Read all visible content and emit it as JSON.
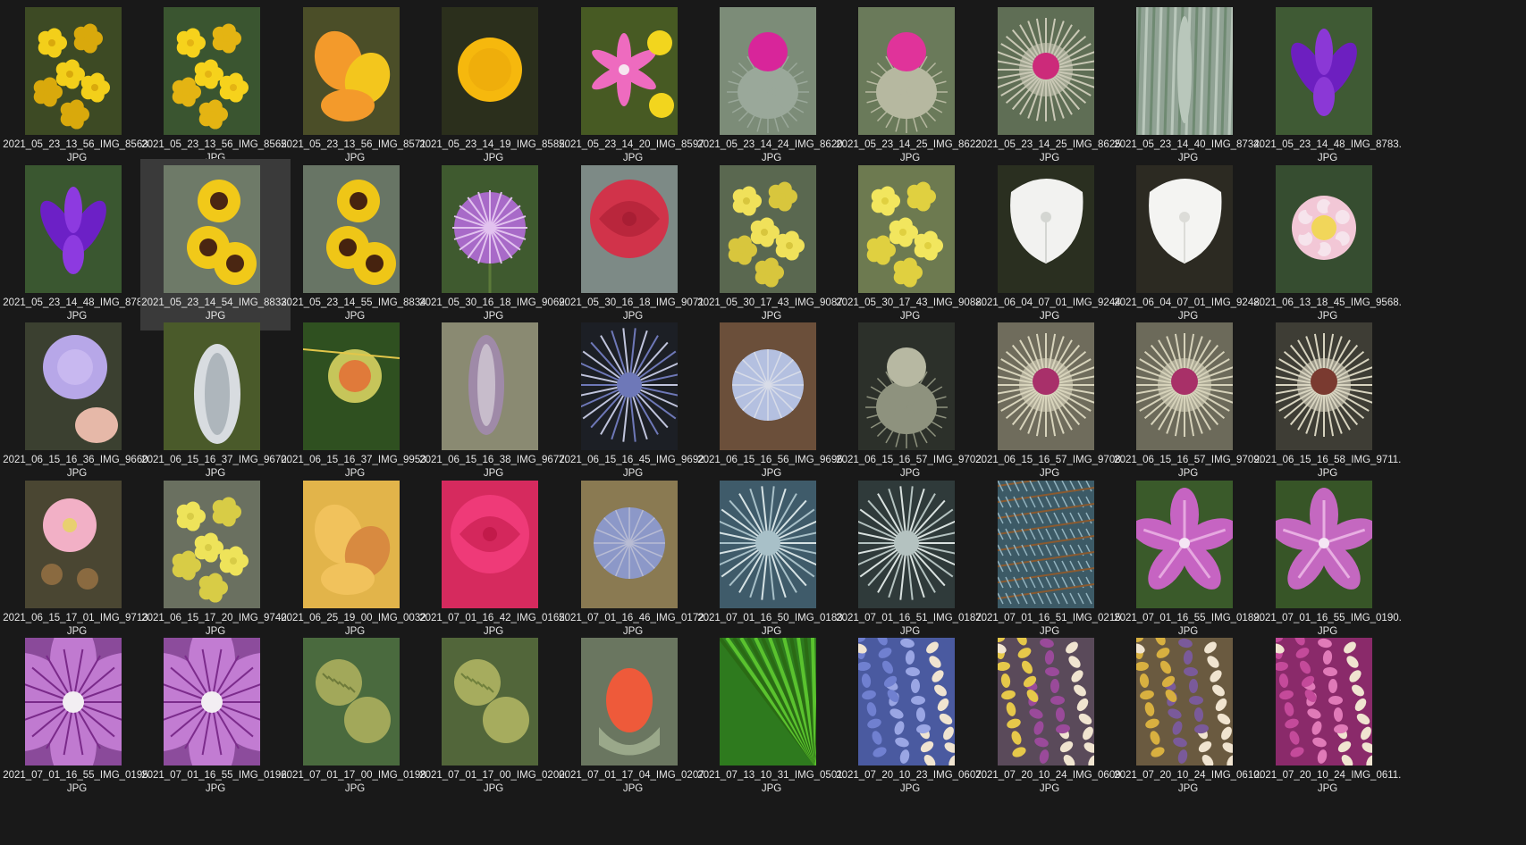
{
  "view": {
    "background": "#191919",
    "selected_index": 11
  },
  "items": [
    {
      "name1": "2021_05_23_13_56_IMG_8563.",
      "name2": "JPG",
      "bg": "#3d4a24",
      "subject": "yellow-blossoms",
      "c1": "#f3cf1a",
      "c2": "#d9a90c"
    },
    {
      "name1": "2021_05_23_13_56_IMG_8565.",
      "name2": "JPG",
      "bg": "#3a5530",
      "subject": "yellow-blossoms",
      "c1": "#f6d21c",
      "c2": "#e4b413"
    },
    {
      "name1": "2021_05_23_13_56_IMG_8571.",
      "name2": "JPG",
      "bg": "#4b4e28",
      "subject": "orange-petals",
      "c1": "#f39a2b",
      "c2": "#f3c61d"
    },
    {
      "name1": "2021_05_23_14_19_IMG_8585.",
      "name2": "JPG",
      "bg": "#2b2f1c",
      "subject": "yellow-button",
      "c1": "#f6b80d",
      "c2": "#e8a309"
    },
    {
      "name1": "2021_05_23_14_20_IMG_8597.",
      "name2": "JPG",
      "bg": "#475a23",
      "subject": "pink-star",
      "c1": "#ee6bbf",
      "c2": "#f2d51e"
    },
    {
      "name1": "2021_05_23_14_24_IMG_8620.",
      "name2": "JPG",
      "bg": "#7c8c78",
      "subject": "thistle",
      "c1": "#d8259a",
      "c2": "#9aa89a"
    },
    {
      "name1": "2021_05_23_14_25_IMG_8622.",
      "name2": "JPG",
      "bg": "#6a7a5a",
      "subject": "thistle",
      "c1": "#e0339a",
      "c2": "#b6b8a0"
    },
    {
      "name1": "2021_05_23_14_25_IMG_8625.",
      "name2": "JPG",
      "bg": "#5f6e55",
      "subject": "thistle-star",
      "c1": "#cc2a7a",
      "c2": "#c9c8b5"
    },
    {
      "name1": "2021_05_23_14_40_IMG_8734.",
      "name2": "JPG",
      "bg": "#90a294",
      "subject": "grass",
      "c1": "#b9c7bb",
      "c2": "#6f8a72"
    },
    {
      "name1": "2021_05_23_14_48_IMG_8783.",
      "name2": "JPG",
      "bg": "#3f5a34",
      "subject": "purple-iris",
      "c1": "#6d1fc0",
      "c2": "#8b38d6"
    },
    {
      "name1": "2021_05_23_14_48_IMG_8784.",
      "name2": "JPG",
      "bg": "#3a5730",
      "subject": "purple-iris",
      "c1": "#6c20c6",
      "c2": "#8d3ae0"
    },
    {
      "name1": "2021_05_23_14_54_IMG_8833.",
      "name2": "JPG",
      "bg": "#6e7a68",
      "subject": "yellow-dark-eye",
      "c1": "#f1c919",
      "c2": "#4a2612"
    },
    {
      "name1": "2021_05_23_14_55_IMG_8834.",
      "name2": "JPG",
      "bg": "#687565",
      "subject": "yellow-dark-eye",
      "c1": "#efc617",
      "c2": "#46230f"
    },
    {
      "name1": "2021_05_30_16_18_IMG_9069.",
      "name2": "JPG",
      "bg": "#3f5a2f",
      "subject": "allium",
      "c1": "#a86ac8",
      "c2": "#e2c2ef"
    },
    {
      "name1": "2021_05_30_16_18_IMG_9071.",
      "name2": "JPG",
      "bg": "#7d8a86",
      "subject": "red-petals",
      "c1": "#d1334a",
      "c2": "#a81e34"
    },
    {
      "name1": "2021_05_30_17_43_IMG_9087.",
      "name2": "JPG",
      "bg": "#5a6850",
      "subject": "yellow-blossoms",
      "c1": "#f0e15a",
      "c2": "#d8c63d"
    },
    {
      "name1": "2021_05_30_17_43_IMG_9088.",
      "name2": "JPG",
      "bg": "#6d7a50",
      "subject": "yellow-blossoms",
      "c1": "#f2e65e",
      "c2": "#e0d040"
    },
    {
      "name1": "2021_06_04_07_01_IMG_9244.",
      "name2": "JPG",
      "bg": "#2a2f20",
      "subject": "white-bell",
      "c1": "#f2f2f0",
      "c2": "#d4d6d2"
    },
    {
      "name1": "2021_06_04_07_01_IMG_9248.",
      "name2": "JPG",
      "bg": "#2c2a22",
      "subject": "white-bell",
      "c1": "#f4f4f2",
      "c2": "#dcdcd8"
    },
    {
      "name1": "2021_06_13_18_45_IMG_9568.",
      "name2": "JPG",
      "bg": "#364d30",
      "subject": "lantana",
      "c1": "#f2c7d6",
      "c2": "#f1d65a"
    },
    {
      "name1": "2021_06_15_16_36_IMG_9660.",
      "name2": "JPG",
      "bg": "#3b4030",
      "subject": "lilac-ball",
      "c1": "#b7a7e8",
      "c2": "#c8b8f0"
    },
    {
      "name1": "2021_06_15_16_37_IMG_9670.",
      "name2": "JPG",
      "bg": "#4a5a2a",
      "subject": "white-spike",
      "c1": "#d8dce0",
      "c2": "#aeb6bc"
    },
    {
      "name1": "2021_06_15_16_37_IMG_9953.",
      "name2": "JPG",
      "bg": "#2f5020",
      "subject": "orange-bud",
      "c1": "#e07a3a",
      "c2": "#c6c55a"
    },
    {
      "name1": "2021_06_15_16_38_IMG_9677.",
      "name2": "JPG",
      "bg": "#8a8a72",
      "subject": "lavender-spike",
      "c1": "#9f8aa8",
      "c2": "#c7bccb"
    },
    {
      "name1": "2021_06_15_16_45_IMG_9692.",
      "name2": "JPG",
      "bg": "#1c1f25",
      "subject": "blue-spikes",
      "c1": "#6e78b8",
      "c2": "#c0c4dc"
    },
    {
      "name1": "2021_06_15_16_56_IMG_9696.",
      "name2": "JPG",
      "bg": "#6b4f3a",
      "subject": "globe",
      "c1": "#b4c0e0",
      "c2": "#d8dce8"
    },
    {
      "name1": "2021_06_15_16_57_IMG_9702.",
      "name2": "JPG",
      "bg": "#2c302a",
      "subject": "thistle",
      "c1": "#b7b8a2",
      "c2": "#8e927e"
    },
    {
      "name1": "2021_06_15_16_57_IMG_9708.",
      "name2": "JPG",
      "bg": "#6f6c5c",
      "subject": "thistle-star",
      "c1": "#a8306a",
      "c2": "#d8d4bc"
    },
    {
      "name1": "2021_06_15_16_57_IMG_9709.",
      "name2": "JPG",
      "bg": "#6c6a5a",
      "subject": "thistle-star",
      "c1": "#a83068",
      "c2": "#d6d2ba"
    },
    {
      "name1": "2021_06_15_16_58_IMG_9711.",
      "name2": "JPG",
      "bg": "#3e3d35",
      "subject": "thistle-star",
      "c1": "#7a3a30",
      "c2": "#d8d4c0"
    },
    {
      "name1": "2021_06_15_17_01_IMG_9713.",
      "name2": "JPG",
      "bg": "#4a4632",
      "subject": "pink-rose",
      "c1": "#f2b0c6",
      "c2": "#e8d070"
    },
    {
      "name1": "2021_06_15_17_20_IMG_9740.",
      "name2": "JPG",
      "bg": "#6a7060",
      "subject": "yellow-blossoms",
      "c1": "#eee35a",
      "c2": "#d8cc46"
    },
    {
      "name1": "2021_06_25_19_00_IMG_0032.",
      "name2": "JPG",
      "bg": "#e2b44a",
      "subject": "orange-petals",
      "c1": "#f1c25c",
      "c2": "#d88a40"
    },
    {
      "name1": "2021_07_01_16_42_IMG_0165.",
      "name2": "JPG",
      "bg": "#d62a5e",
      "subject": "red-petals",
      "c1": "#ef3a78",
      "c2": "#c21a4a"
    },
    {
      "name1": "2021_07_01_16_46_IMG_0172.",
      "name2": "JPG",
      "bg": "#8a7a52",
      "subject": "globe",
      "c1": "#8c98c8",
      "c2": "#b8bcd4"
    },
    {
      "name1": "2021_07_01_16_50_IMG_0183.",
      "name2": "JPG",
      "bg": "#3f5b6a",
      "subject": "blue-spikes",
      "c1": "#a8c0c8",
      "c2": "#d6e2e4"
    },
    {
      "name1": "2021_07_01_16_51_IMG_0187.",
      "name2": "JPG",
      "bg": "#2f3a3a",
      "subject": "blue-spikes",
      "c1": "#b4c2c0",
      "c2": "#dae2e0"
    },
    {
      "name1": "2021_07_01_16_51_IMG_0215.",
      "name2": "JPG",
      "bg": "#3c5a66",
      "subject": "spruce",
      "c1": "#92b2be",
      "c2": "#8a5a30"
    },
    {
      "name1": "2021_07_01_16_55_IMG_0189.",
      "name2": "JPG",
      "bg": "#3a5a2a",
      "subject": "mallow",
      "c1": "#c664c2",
      "c2": "#e6a8e0"
    },
    {
      "name1": "2021_07_01_16_55_IMG_0190.",
      "name2": "JPG",
      "bg": "#375527",
      "subject": "mallow",
      "c1": "#c468c0",
      "c2": "#e8aee2"
    },
    {
      "name1": "2021_07_01_16_55_IMG_0195.",
      "name2": "JPG",
      "bg": "#8a4a9a",
      "subject": "mallow-close",
      "c1": "#c07ad0",
      "c2": "#7a2a8a"
    },
    {
      "name1": "2021_07_01_16_55_IMG_0196.",
      "name2": "JPG",
      "bg": "#8c4c9c",
      "subject": "mallow-close",
      "c1": "#c27cd2",
      "c2": "#7c2c8c"
    },
    {
      "name1": "2021_07_01_17_00_IMG_0198.",
      "name2": "JPG",
      "bg": "#4a6a3e",
      "subject": "artichoke",
      "c1": "#a2a85a",
      "c2": "#6e7a3a"
    },
    {
      "name1": "2021_07_01_17_00_IMG_0200.",
      "name2": "JPG",
      "bg": "#52663a",
      "subject": "artichoke",
      "c1": "#a6ac5e",
      "c2": "#70803c"
    },
    {
      "name1": "2021_07_01_17_04_IMG_0207.",
      "name2": "JPG",
      "bg": "#6a7660",
      "subject": "rose-bud",
      "c1": "#ee5a3a",
      "c2": "#9aa88a"
    },
    {
      "name1": "2021_07_13_10_31_IMG_0501.",
      "name2": "JPG",
      "bg": "#2e7a1e",
      "subject": "palm",
      "c1": "#5ac22e",
      "c2": "#2a6a14"
    },
    {
      "name1": "2021_07_20_10_23_IMG_0607.",
      "name2": "JPG",
      "bg": "#4a5aa0",
      "subject": "petals-mix",
      "c1": "#7080d0",
      "c2": "#9aa6e4"
    },
    {
      "name1": "2021_07_20_10_24_IMG_0609.",
      "name2": "JPG",
      "bg": "#5a4a5a",
      "subject": "petals-mix",
      "c1": "#e6c84a",
      "c2": "#9a4a9a"
    },
    {
      "name1": "2021_07_20_10_24_IMG_0610.",
      "name2": "JPG",
      "bg": "#6a5a40",
      "subject": "petals-mix",
      "c1": "#d8b040",
      "c2": "#7a5a9a"
    },
    {
      "name1": "2021_07_20_10_24_IMG_0611.",
      "name2": "JPG",
      "bg": "#8a2a6a",
      "subject": "petals-mix",
      "c1": "#c44a9a",
      "c2": "#e07ab8"
    }
  ]
}
